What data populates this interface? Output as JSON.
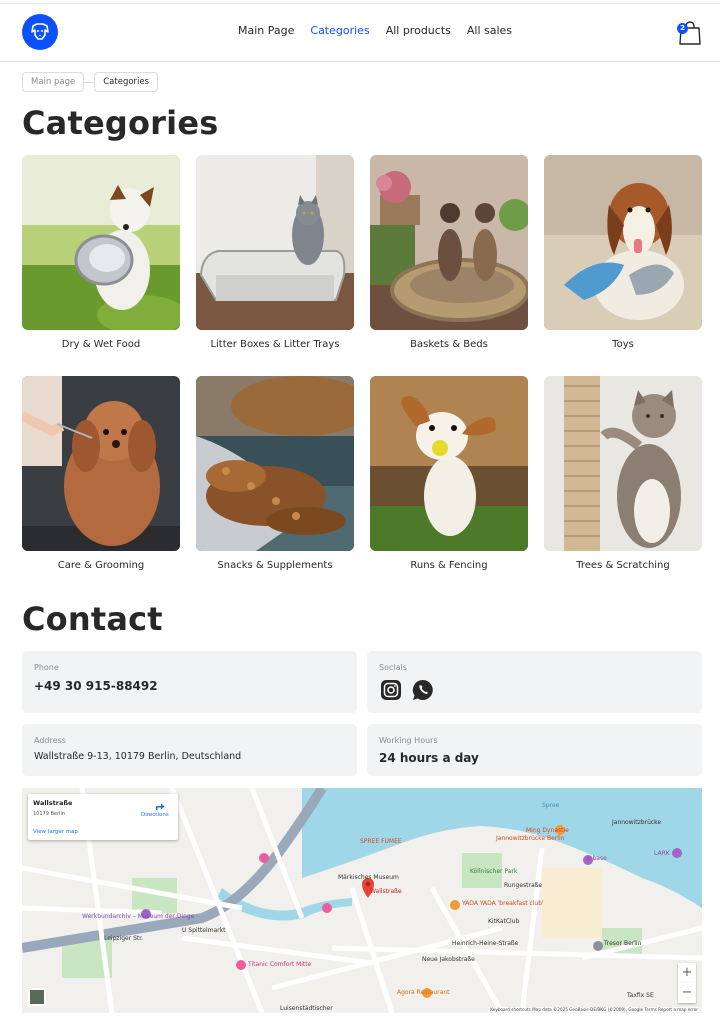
{
  "header": {
    "nav": [
      {
        "label": "Main Page",
        "active": false
      },
      {
        "label": "Categories",
        "active": true
      },
      {
        "label": "All products",
        "active": false
      },
      {
        "label": "All sales",
        "active": false
      }
    ],
    "cart_count": "2",
    "brand_color": "#0d50ff"
  },
  "breadcrumb": [
    "Main page",
    "Categories"
  ],
  "categories": {
    "title": "Categories",
    "items": [
      {
        "label": "Dry & Wet Food"
      },
      {
        "label": "Litter Boxes & Litter Trays"
      },
      {
        "label": "Baskets & Beds"
      },
      {
        "label": "Toys"
      },
      {
        "label": "Care & Grooming"
      },
      {
        "label": "Snacks & Supplements"
      },
      {
        "label": "Runs & Fencing"
      },
      {
        "label": "Trees & Scratching"
      }
    ]
  },
  "contact": {
    "title": "Contact",
    "phone": {
      "caption": "Phone",
      "value": "+49 30 915-88492"
    },
    "socials": {
      "caption": "Socials",
      "icons": [
        "instagram-icon",
        "whatsapp-icon"
      ]
    },
    "address": {
      "caption": "Address",
      "value": "Wallstraße 9-13, 10179 Berlin, Deutschland"
    },
    "hours": {
      "caption": "Working Hours",
      "value": "24 hours a day"
    }
  },
  "map": {
    "card_title": "Wallstraße",
    "card_sub": "10179 Berlin",
    "directions": "Directions",
    "larger_map": "View larger map",
    "labels": [
      "Spree",
      "SPREE FUMEE",
      "Ming Dynastie",
      "Jannowitzbrücke Berlin",
      "Jannowitzbrücke",
      "Märkisches Museum",
      "Wallstraße",
      "YADA YADA 'breakfast club'",
      "KitKatClub",
      "Heinrich-Heine-Straße",
      "Werkbundarchiv – Museum der Dinge",
      "U Spittelmarkt",
      "Titanic Comfort Mitte",
      "Agora Restaurant",
      "Tresor Berlin",
      "Rungestraße",
      "Köllnischer Park",
      "Leipziger Str.",
      "Neue Jakobstraße",
      "c-base",
      "LARK",
      "Taxfix SE",
      "Luisenstädtischer"
    ],
    "footer": "Keyboard shortcuts   Map data ©2025 GeoBasis-DE/BKG (©2009), Google   Terms   Report a map error",
    "zoom_in": "+",
    "zoom_out": "−"
  }
}
